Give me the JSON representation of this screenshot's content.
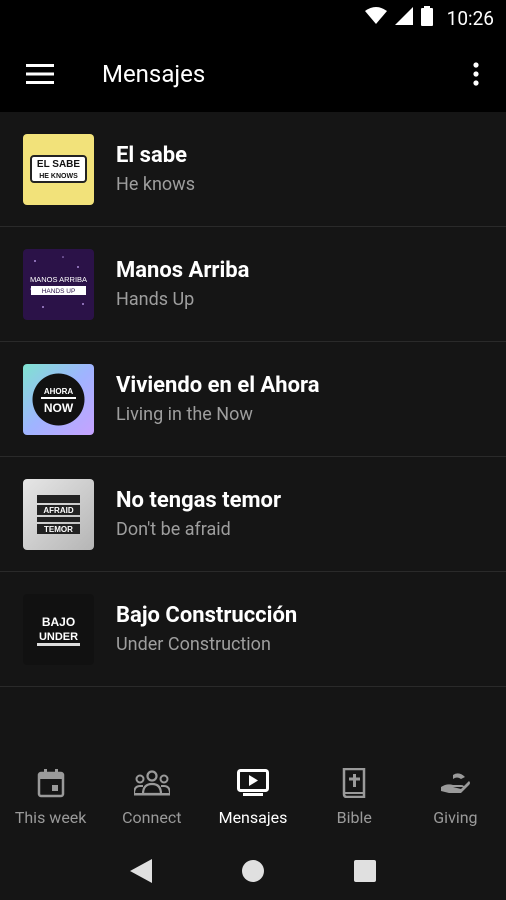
{
  "status_bar": {
    "time": "10:26"
  },
  "app_bar": {
    "title": "Mensajes"
  },
  "messages": [
    {
      "title": "El sabe",
      "subtitle": "He knows",
      "thumb_line1": "EL SABE",
      "thumb_line2": "HE KNOWS",
      "thumb_bg": "#f2e27a"
    },
    {
      "title": "Manos Arriba",
      "subtitle": "Hands Up",
      "thumb_line1": "MANOS ARRIBA",
      "thumb_line2": "HANDS UP",
      "thumb_bg": "#2b1248"
    },
    {
      "title": "Viviendo en el Ahora",
      "subtitle": "Living in the Now",
      "thumb_line1": "AHORA",
      "thumb_line2": "NOW",
      "thumb_bg": "#8fd3f4"
    },
    {
      "title": "No tengas temor",
      "subtitle": "Don't be afraid",
      "thumb_line1": "AFRAID",
      "thumb_line2": "TEMOR",
      "thumb_bg": "#cfcfcf"
    },
    {
      "title": "Bajo Construcción",
      "subtitle": "Under Construction",
      "thumb_line1": "BAJO",
      "thumb_line2": "UNDER",
      "thumb_bg": "#111111"
    }
  ],
  "bottom_nav": [
    {
      "label": "This week",
      "icon": "calendar-icon",
      "active": false
    },
    {
      "label": "Connect",
      "icon": "people-icon",
      "active": false
    },
    {
      "label": "Mensajes",
      "icon": "play-video-icon",
      "active": true
    },
    {
      "label": "Bible",
      "icon": "bible-icon",
      "active": false
    },
    {
      "label": "Giving",
      "icon": "giving-hand-icon",
      "active": false
    }
  ],
  "colors": {
    "background": "#151515",
    "bar": "#000000",
    "subtitle": "#9e9e9e",
    "inactive_nav": "#9a9a9a"
  }
}
